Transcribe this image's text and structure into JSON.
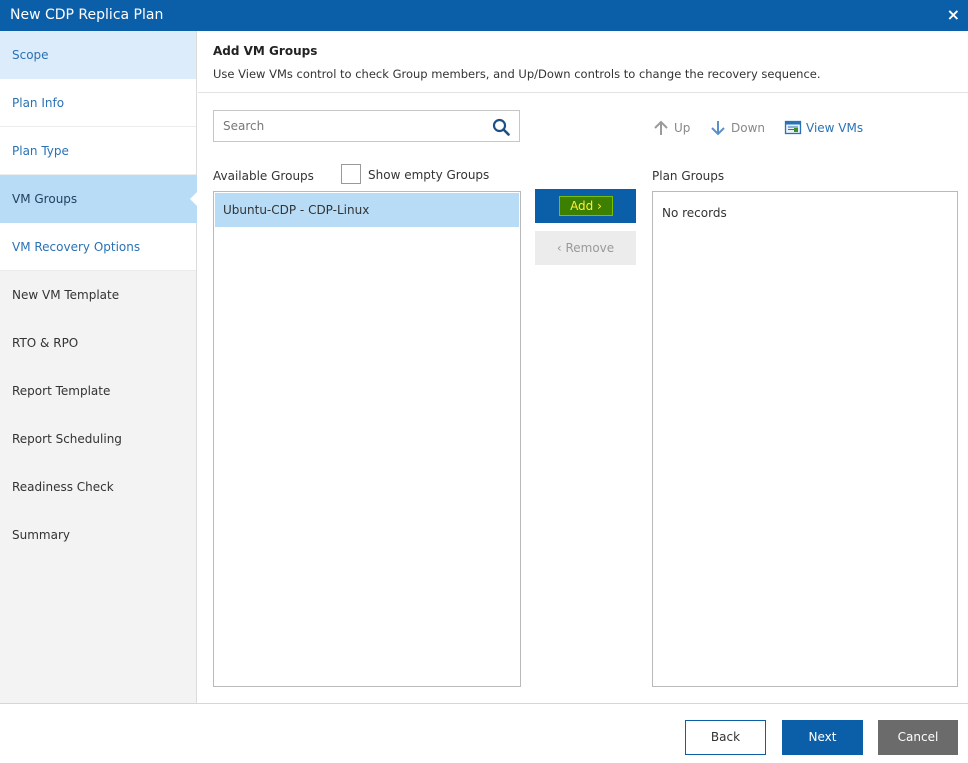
{
  "window": {
    "title": "New CDP Replica Plan",
    "close_icon": "×"
  },
  "steps": [
    {
      "label": "Scope"
    },
    {
      "label": "Plan Info"
    },
    {
      "label": "Plan Type"
    },
    {
      "label": "VM Groups"
    },
    {
      "label": "VM Recovery Options"
    },
    {
      "label": "New VM Template"
    },
    {
      "label": "RTO & RPO"
    },
    {
      "label": "Report Template"
    },
    {
      "label": "Report Scheduling"
    },
    {
      "label": "Readiness Check"
    },
    {
      "label": "Summary"
    }
  ],
  "main": {
    "title": "Add VM Groups",
    "description": "Use View VMs control to check Group members, and Up/Down controls to change the recovery sequence.",
    "search": {
      "placeholder": "Search",
      "value": ""
    },
    "toolbar": {
      "up": "Up",
      "down": "Down",
      "view_vms": "View VMs"
    },
    "available_label": "Available Groups",
    "show_empty_label": "Show empty Groups",
    "plan_groups_label": "Plan Groups",
    "available_groups": [
      "Ubuntu-CDP - CDP-Linux"
    ],
    "plan_groups_empty": "No records",
    "add_label": "Add",
    "remove_label": "Remove"
  },
  "footer": {
    "back": "Back",
    "next": "Next",
    "cancel": "Cancel"
  },
  "colors": {
    "primary": "#0b5ea8",
    "selected": "#b8dcf6",
    "link": "#2a72b5"
  }
}
